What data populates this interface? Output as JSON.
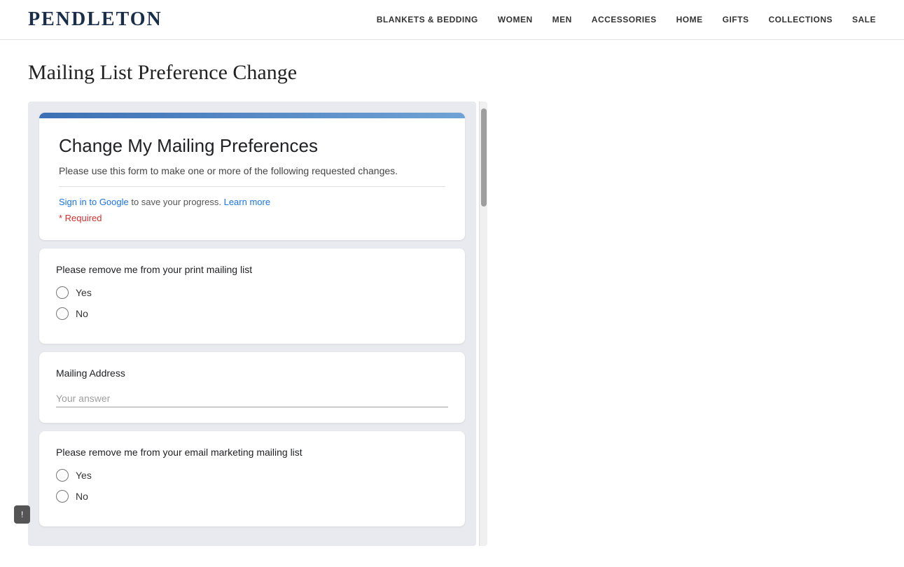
{
  "logo": {
    "text": "PENDLETON"
  },
  "nav": {
    "items": [
      {
        "label": "BLANKETS & BEDDING",
        "id": "blankets-bedding"
      },
      {
        "label": "WOMEN",
        "id": "women"
      },
      {
        "label": "MEN",
        "id": "men"
      },
      {
        "label": "ACCESSORIES",
        "id": "accessories"
      },
      {
        "label": "HOME",
        "id": "home"
      },
      {
        "label": "GIFTS",
        "id": "gifts"
      },
      {
        "label": "COLLECTIONS",
        "id": "collections"
      },
      {
        "label": "SALE",
        "id": "sale"
      }
    ]
  },
  "page": {
    "title": "Mailing List Preference Change"
  },
  "form": {
    "title": "Change My Mailing Preferences",
    "subtitle": "Please use this form to make one or more of the following requested changes.",
    "sign_in_text": " to save your progress.",
    "sign_in_link": "Sign in to Google",
    "learn_more_link": "Learn more",
    "required_label": "* Required",
    "questions": [
      {
        "id": "q1",
        "label": "Please remove me from your print mailing list",
        "type": "radio",
        "options": [
          "Yes",
          "No"
        ]
      },
      {
        "id": "q2",
        "label": "Mailing Address",
        "type": "text",
        "placeholder": "Your answer"
      },
      {
        "id": "q3",
        "label": "Please remove me from your email marketing mailing list",
        "type": "radio",
        "options": [
          "Yes",
          "No"
        ]
      }
    ]
  },
  "feedback": {
    "label": "!"
  }
}
